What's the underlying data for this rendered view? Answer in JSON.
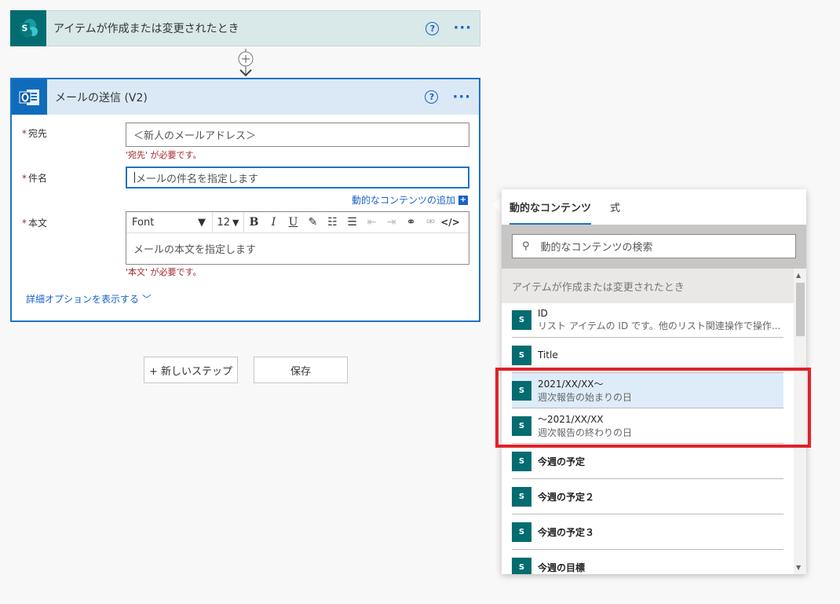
{
  "trigger": {
    "title": "アイテムが作成または変更されたとき",
    "help": "?",
    "more": "···"
  },
  "action": {
    "title": "メールの送信 (V2)",
    "help": "?",
    "more": "···",
    "to_label": "宛先",
    "to_value": "＜新人のメールアドレス＞",
    "to_error": "'宛先' が必要です。",
    "subject_label": "件名",
    "subject_placeholder": "メールの件名を指定します",
    "dynamic_link": "動的なコンテンツの追加",
    "body_label": "本文",
    "body_placeholder": "メールの本文を指定します",
    "body_error": "'本文' が必要です。",
    "toolbar": {
      "font": "Font",
      "size": "12"
    },
    "advanced": "詳細オプションを表示する"
  },
  "buttons": {
    "new_step": "+ 新しいステップ",
    "save": "保存"
  },
  "panel": {
    "tabs": [
      "動的なコンテンツ",
      "式"
    ],
    "search_placeholder": "動的なコンテンツの検索",
    "group": "アイテムが作成または変更されたとき",
    "items": [
      {
        "title": "ID",
        "desc": "リスト アイテムの ID です。他のリスト関連操作で操作..."
      },
      {
        "title": "Title",
        "desc": ""
      },
      {
        "title": "2021/XX/XX～",
        "desc": "週次報告の始まりの日"
      },
      {
        "title": "～2021/XX/XX",
        "desc": "週次報告の終わりの日"
      },
      {
        "title": "今週の予定",
        "desc": ""
      },
      {
        "title": "今週の予定２",
        "desc": ""
      },
      {
        "title": "今週の予定３",
        "desc": ""
      },
      {
        "title": "今週の目標",
        "desc": ""
      }
    ]
  },
  "colors": {
    "accent": "#1f72c7",
    "sharepoint": "#036c70",
    "error": "#a4262c",
    "highlight": "#e0222a"
  }
}
